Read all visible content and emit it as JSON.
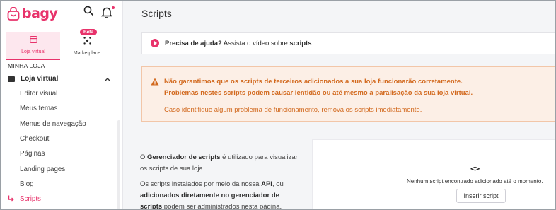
{
  "brand": {
    "name": "bagy",
    "accent": "#e8336b"
  },
  "topbar": {
    "search_icon": "search-icon",
    "bell_icon": "bell-icon"
  },
  "modules": [
    {
      "label": "Loja virtual",
      "active": true
    },
    {
      "label": "Marketplace",
      "badge": "Beta",
      "active": false
    }
  ],
  "sidebar": {
    "section_title": "MINHA LOJA",
    "group": {
      "label": "Loja virtual"
    },
    "items": [
      {
        "label": "Editor visual"
      },
      {
        "label": "Meus temas"
      },
      {
        "label": "Menus de navegação"
      },
      {
        "label": "Checkout"
      },
      {
        "label": "Páginas"
      },
      {
        "label": "Landing pages"
      },
      {
        "label": "Blog"
      },
      {
        "label": "Scripts",
        "active": true
      }
    ]
  },
  "page": {
    "title": "Scripts"
  },
  "help": {
    "bold": "Precisa de ajuda?",
    "text": " Assista o vídeo sobre ",
    "link": "scripts"
  },
  "warning": {
    "line1": "Não garantimos que os scripts de terceiros adicionados a sua loja funcionarão corretamente.",
    "line2": "Problemas nestes scripts podem causar lentidão ou até mesmo a paralisação da sua loja virtual.",
    "line3": "Caso identifique algum problema de funcionamento, remova os scripts imediatamente.",
    "color": "#d2691e"
  },
  "description": {
    "p1_prefix": "O ",
    "p1_bold": "Gerenciador de scripts",
    "p1_rest": " é utilizado para visualizar os scripts de sua loja.",
    "p2_prefix": "Os scripts instalados por meio da nossa ",
    "p2_bold1": "API",
    "p2_mid": ", ou ",
    "p2_bold2": "adicionados diretamente no gerenciador de scripts",
    "p2_rest": " podem ser administrados nesta página."
  },
  "empty_state": {
    "icon": "code-icon",
    "text": "Nenhum script encontrado adicionado até o momento.",
    "button": "Inserir script"
  }
}
